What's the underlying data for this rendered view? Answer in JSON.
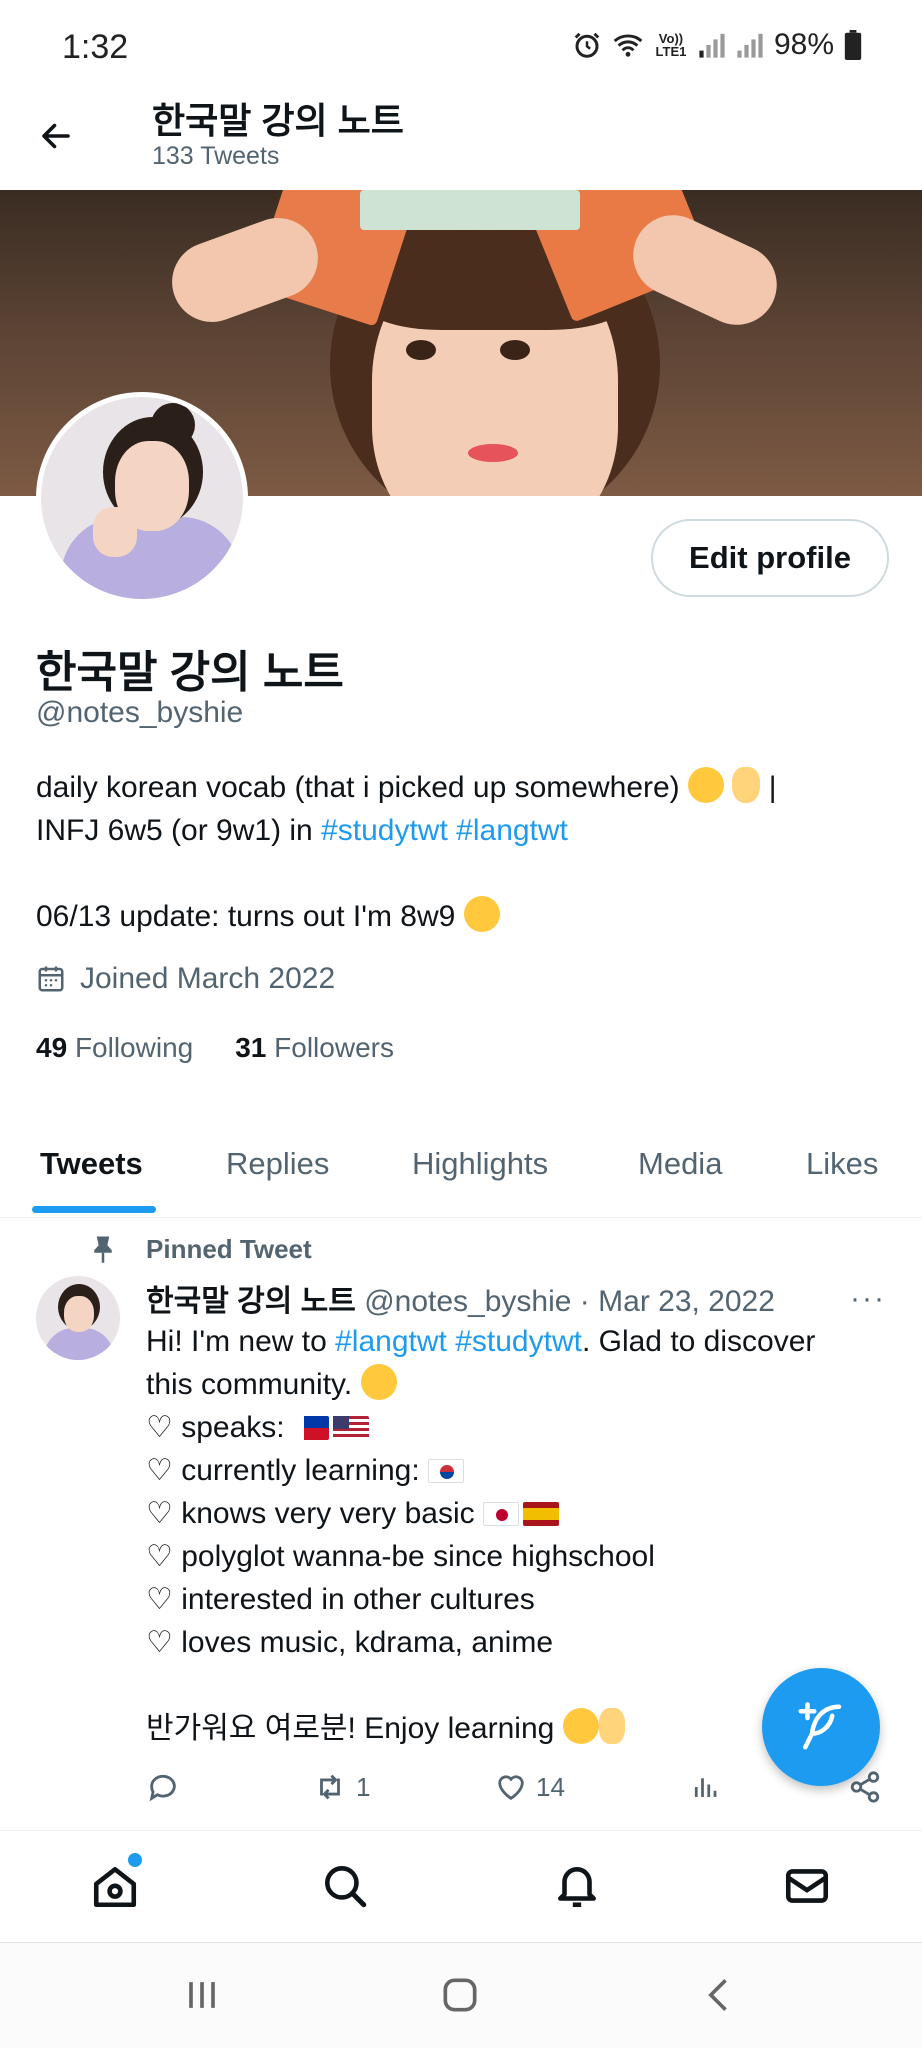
{
  "status_bar": {
    "time": "1:32",
    "network_label": "Vo)) LTE1",
    "battery": "98%"
  },
  "header": {
    "title": "한국말 강의 노트",
    "subtitle": "133 Tweets"
  },
  "profile": {
    "edit_button": "Edit profile",
    "name": "한국말 강의 노트",
    "handle": "@notes_byshie",
    "bio_line1_text": "daily korean vocab (that i picked up somewhere)",
    "bio_line1_suffix": " |",
    "bio_line2_text": "INFJ 6w5 (or 9w1) in ",
    "bio_hashtag1": "#studytwt",
    "bio_hashtag2": "#langtwt",
    "bio_update": "06/13 update: turns out I'm 8w9",
    "joined": "Joined March 2022",
    "following_count": "49",
    "following_label": "Following",
    "followers_count": "31",
    "followers_label": "Followers"
  },
  "tabs": [
    "Tweets",
    "Replies",
    "Highlights",
    "Media",
    "Likes"
  ],
  "pinned_tweet": {
    "pinned_label": "Pinned Tweet",
    "author_name": "한국말 강의 노트",
    "author_handle": "@notes_byshie",
    "separator": " · ",
    "date": "Mar 23, 2022",
    "more": "···",
    "line1_a": "Hi! I'm new to ",
    "line1_tag1": "#langtwt",
    "line1_tag2": "#studytwt",
    "line1_b": ". Glad to discover",
    "line2": "this community.",
    "line3": "♡ speaks:",
    "line4": "♡ currently learning:",
    "line5": "♡ knows very very basic",
    "line6": "♡ polyglot wanna-be since highschool",
    "line7": "♡ interested in other cultures",
    "line8": "♡ loves music, kdrama, anime",
    "line9": "반가워요 여로분! Enjoy learning",
    "retweets": "1",
    "likes": "14"
  },
  "icons": {
    "back": "back-arrow-icon",
    "calendar": "calendar-icon",
    "pin": "pin-icon",
    "reply": "reply-icon",
    "retweet": "retweet-icon",
    "like": "heart-icon",
    "views": "views-icon",
    "share": "share-icon",
    "compose": "compose-icon",
    "home": "home-icon",
    "search": "search-icon",
    "notifications": "bell-icon",
    "messages": "mail-icon"
  },
  "colors": {
    "accent": "#1d9bf0",
    "secondary_text": "#536471",
    "primary_text": "#0f1419"
  }
}
